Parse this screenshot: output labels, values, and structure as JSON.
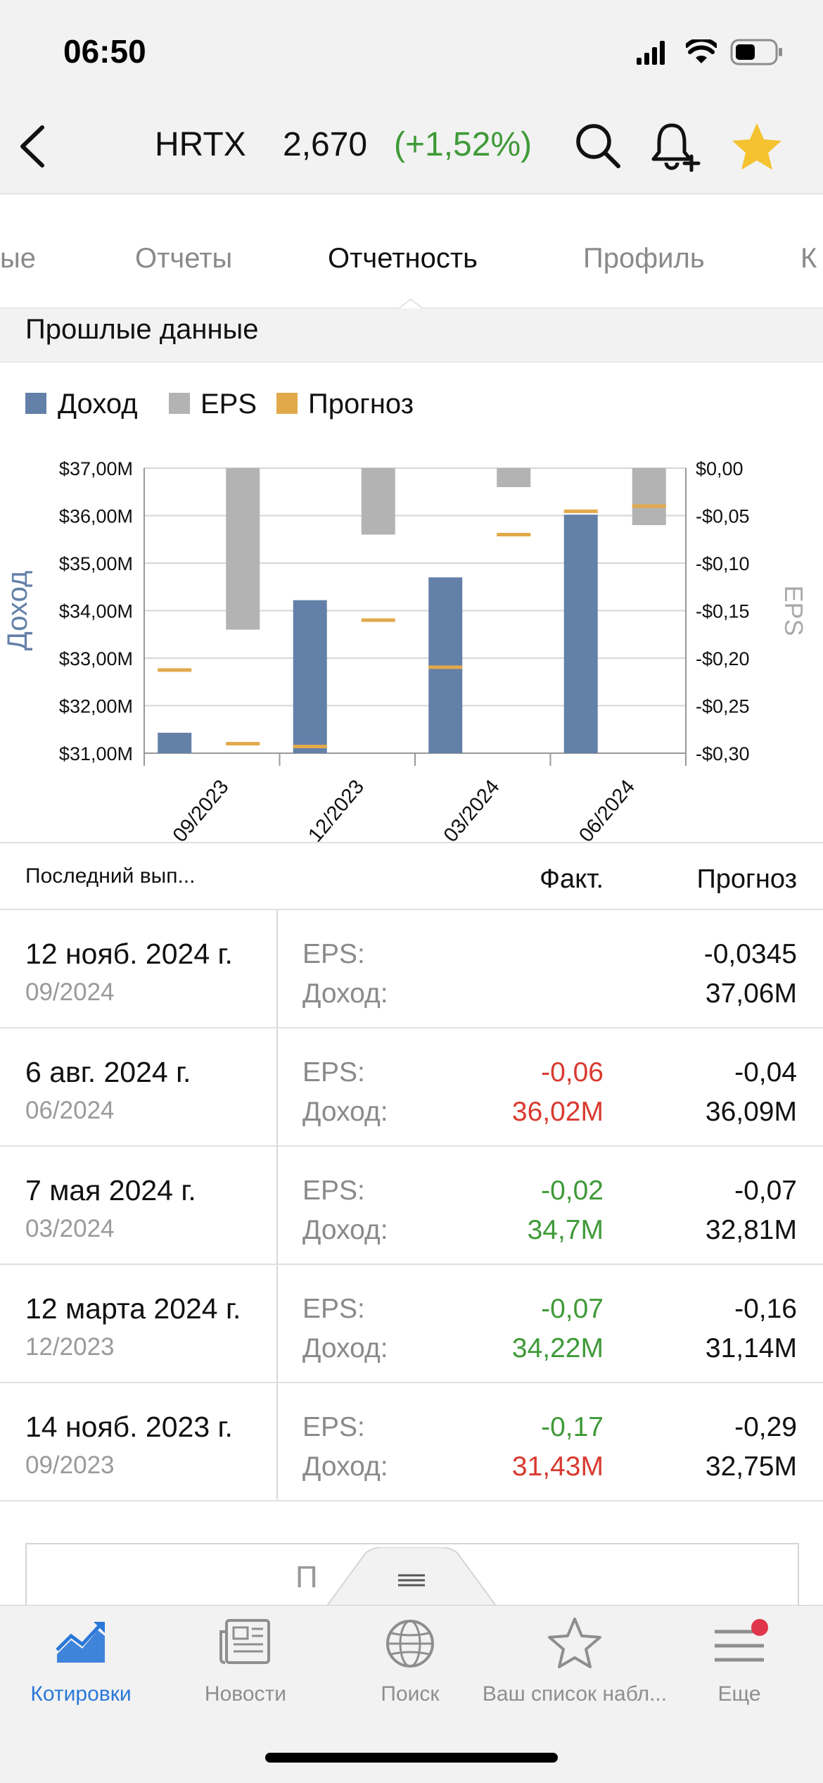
{
  "status": {
    "time": "06:50"
  },
  "header": {
    "ticker": "HRTX",
    "price": "2,670",
    "change": "(+1,52%)"
  },
  "tabs": [
    "ые",
    "Отчеты",
    "Отчетность",
    "Профиль",
    "К"
  ],
  "section": {
    "title": "Прошлые данные"
  },
  "legend": [
    {
      "label": "Доход",
      "color": "#6380a8"
    },
    {
      "label": "EPS",
      "color": "#b3b3b3"
    },
    {
      "label": "Прогноз",
      "color": "#e2a94b"
    }
  ],
  "chart_data": {
    "type": "bar",
    "categories": [
      "09/2023",
      "12/2023",
      "03/2024",
      "06/2024"
    ],
    "ylabel": "Доход",
    "y2label": "EPS",
    "ylim": [
      31,
      37
    ],
    "y2lim": [
      -0.3,
      0
    ],
    "y_ticks": [
      "$37,00M",
      "$36,00M",
      "$35,00M",
      "$34,00M",
      "$33,00M",
      "$32,00M",
      "$31,00M"
    ],
    "y2_ticks": [
      "$0,00",
      "-$0,05",
      "-$0,10",
      "-$0,15",
      "-$0,20",
      "-$0,25",
      "-$0,30"
    ],
    "series": [
      {
        "name": "Доход",
        "values": [
          31.43,
          34.22,
          34.7,
          36.02
        ],
        "forecast": [
          32.75,
          31.14,
          32.81,
          36.09
        ]
      },
      {
        "name": "EPS",
        "values": [
          -0.17,
          -0.07,
          -0.02,
          -0.06
        ],
        "forecast": [
          -0.29,
          -0.16,
          -0.07,
          -0.04
        ]
      }
    ],
    "grid": true
  },
  "table": {
    "col1": "Последний вып...",
    "col2": "Факт.",
    "col3": "Прогноз",
    "rows": [
      {
        "date": "12 нояб. 2024 г.",
        "period": "09/2024",
        "eps_label": "EPS:",
        "rev_label": "Доход:",
        "eps_fact": "",
        "rev_fact": "",
        "eps_fcst": "-0,0345",
        "rev_fcst": "37,06M"
      },
      {
        "date": "6 авг. 2024 г.",
        "period": "06/2024",
        "eps_label": "EPS:",
        "rev_label": "Доход:",
        "eps_fact": "-0,06",
        "rev_fact": "36,02M",
        "eps_fcst": "-0,04",
        "rev_fcst": "36,09M"
      },
      {
        "date": "7 мая 2024 г.",
        "period": "03/2024",
        "eps_label": "EPS:",
        "rev_label": "Доход:",
        "eps_fact": "-0,02",
        "rev_fact": "34,7M",
        "eps_fcst": "-0,07",
        "rev_fcst": "32,81M"
      },
      {
        "date": "12 марта 2024 г.",
        "period": "12/2023",
        "eps_label": "EPS:",
        "rev_label": "Доход:",
        "eps_fact": "-0,07",
        "rev_fact": "34,22M",
        "eps_fcst": "-0,16",
        "rev_fcst": "31,14M"
      },
      {
        "date": "14 нояб. 2023 г.",
        "period": "09/2023",
        "eps_label": "EPS:",
        "rev_label": "Доход:",
        "eps_fact": "-0,17",
        "rev_fact": "31,43M",
        "eps_fcst": "-0,29",
        "rev_fcst": "32,75M"
      }
    ]
  },
  "partial_button": {
    "text": "П            е"
  },
  "bottom_tabs": [
    {
      "label": "Котировки",
      "icon": "chart-trend-icon",
      "active": true
    },
    {
      "label": "Новости",
      "icon": "newspaper-icon",
      "active": false
    },
    {
      "label": "Поиск",
      "icon": "globe-icon",
      "active": false
    },
    {
      "label": "Ваш список набл...",
      "icon": "star-outline-icon",
      "active": false
    },
    {
      "label": "Еще",
      "icon": "menu-icon",
      "active": false
    }
  ],
  "colors": {
    "accent": "#2a78d8",
    "positive": "#3f9a38",
    "negative": "#d93a2f",
    "star": "#f5c230",
    "badge": "#e0354a"
  }
}
